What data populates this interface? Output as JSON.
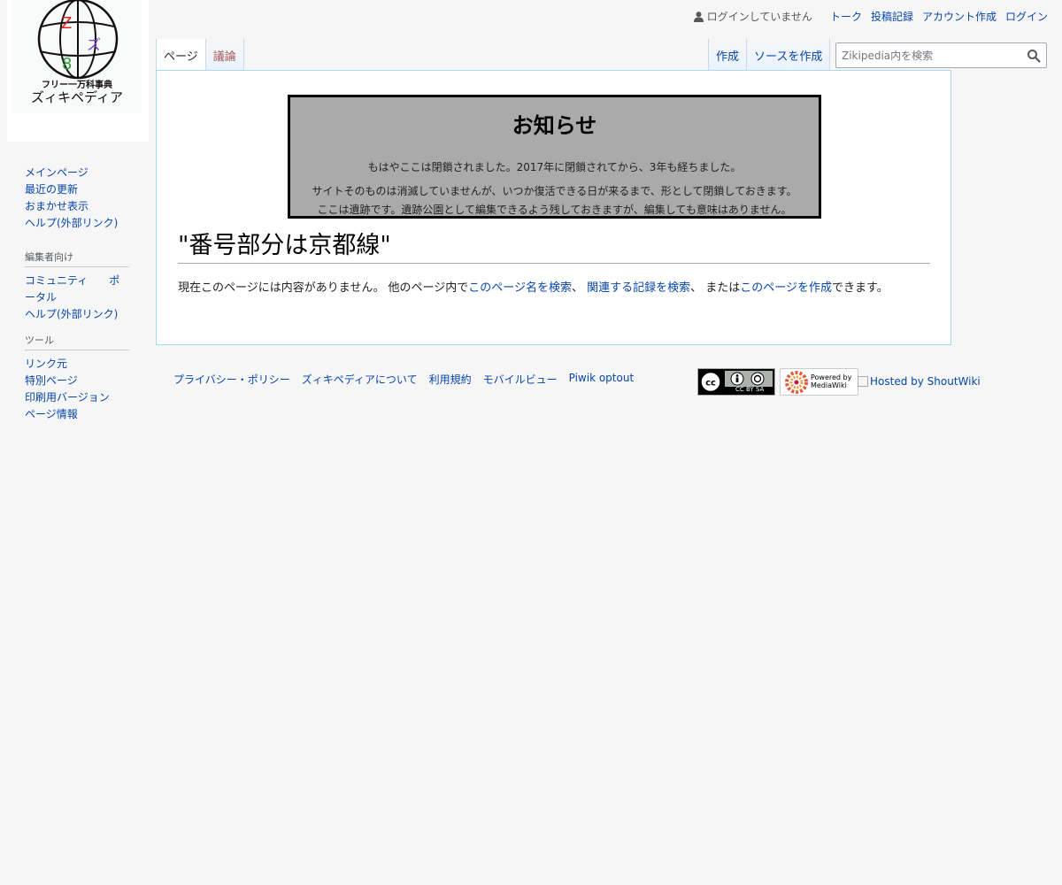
{
  "logo": {
    "subtitle": "フリー一万科事典",
    "name": "ズィキペディア"
  },
  "personal": {
    "anon_label": "ログインしていません",
    "links": [
      "トーク",
      "投稿記録",
      "アカウント作成",
      "ログイン"
    ]
  },
  "tabs": {
    "left": [
      {
        "label": "ページ",
        "selected": true
      },
      {
        "label": "議論",
        "selected": false
      }
    ],
    "right": [
      {
        "label": "作成"
      },
      {
        "label": "ソースを作成"
      }
    ]
  },
  "search": {
    "placeholder": "Zikipedia内を検索",
    "value": ""
  },
  "notice": {
    "title": "お知らせ",
    "line1": "もはやここは閉鎖されました。2017年に閉鎖されてから、3年も経ちました。",
    "line2": "サイトそのものは消滅していませんが、いつか復活できる日が来るまで、形として閉鎖しておきます。",
    "line3": "ここは遺跡です。遺跡公園として編集できるよう残しておきますが、編集しても意味はありません。"
  },
  "page": {
    "title": "\"番号部分は京都線\"",
    "text_1": "現在このページには内容がありません。 他のページ内で",
    "link_1": "このページ名を検索",
    "sep_1": "、 ",
    "link_2": "関連する記録を検索",
    "text_2": "、 または",
    "link_3": "このページを作成",
    "text_3": "できます。"
  },
  "sidebar": {
    "nav": [
      "メインページ",
      "最近の更新",
      "おまかせ表示",
      "ヘルプ(外部リンク)"
    ],
    "editors_heading": "編集者向け",
    "editors": [
      "コミュニティ　　ポータル",
      "ヘルプ(外部リンク)"
    ],
    "tools_heading": "ツール",
    "tools": [
      "リンク元",
      "特別ページ",
      "印刷用バージョン",
      "ページ情報"
    ]
  },
  "footer": {
    "links": [
      "プライバシー・ポリシー",
      "ズィキペディアについて",
      "利用規約",
      "モバイルビュー",
      "Piwik optout"
    ],
    "cc_badge": "CC BY SA",
    "mw_badge": "Powered by MediaWiki",
    "hosted": "Hosted by ShoutWiki"
  },
  "colors": {
    "link": "#0645ad",
    "new_link": "#a55858",
    "background": "#f6f6f6",
    "notice_bg": "#aaaaaa",
    "content_border": "#a7d7f9"
  }
}
